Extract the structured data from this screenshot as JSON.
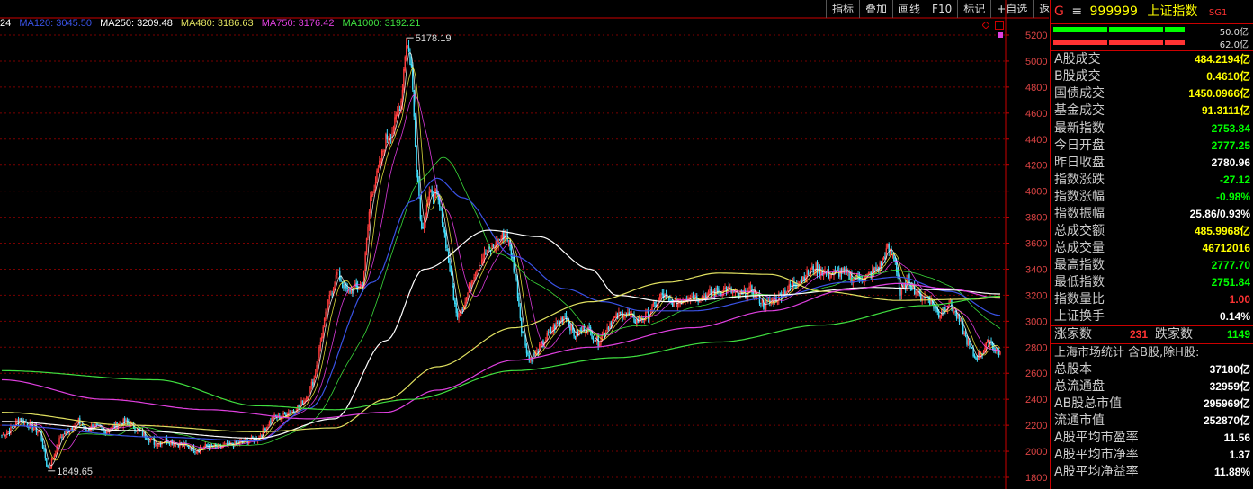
{
  "ma_legend": [
    {
      "label": "24",
      "color": "#ffffff"
    },
    {
      "label": "MA120: 3045.50",
      "color": "#3a53e6"
    },
    {
      "label": "MA250: 3209.48",
      "color": "#ffffff"
    },
    {
      "label": "MA480: 3186.63",
      "color": "#e0e060"
    },
    {
      "label": "MA750: 3176.42",
      "color": "#e040e0"
    },
    {
      "label": "MA1000: 3192.21",
      "color": "#40e040"
    }
  ],
  "toolbar": [
    "指标",
    "叠加",
    "画线",
    "F10",
    "标记",
    "+自选",
    "返回"
  ],
  "quote": {
    "g": "G",
    "eq": "≡",
    "code": "999999",
    "name": "上证指数",
    "sg": "SG1",
    "ratio_top": "50.0亿",
    "ratio_bottom": "62.0亿",
    "ratio_top_fill": 0.5,
    "ratio_bottom_fill": 0.62,
    "colors": {
      "up": "#ff3333",
      "down": "#00ff00",
      "flat": "#ffffff",
      "accent": "#ffff00"
    }
  },
  "volume_rows": [
    {
      "label": "A股成交",
      "value": "484.2194亿"
    },
    {
      "label": "B股成交",
      "value": "0.4610亿"
    },
    {
      "label": "国债成交",
      "value": "1450.0966亿"
    },
    {
      "label": "基金成交",
      "value": "91.3111亿"
    }
  ],
  "index_rows": [
    {
      "label": "最新指数",
      "value": "2753.84",
      "color": "g2"
    },
    {
      "label": "今日开盘",
      "value": "2777.25",
      "color": "g2"
    },
    {
      "label": "昨日收盘",
      "value": "2780.96",
      "color": "w"
    },
    {
      "label": "指数涨跌",
      "value": "-27.12",
      "color": "g2"
    },
    {
      "label": "指数涨幅",
      "value": "-0.98%",
      "color": "g2"
    },
    {
      "label": "指数振幅",
      "value": "25.86/0.93%",
      "color": "w"
    },
    {
      "label": "总成交额",
      "value": "485.9968亿",
      "color": "y"
    },
    {
      "label": "总成交量",
      "value": "46712016",
      "color": "y"
    },
    {
      "label": "最高指数",
      "value": "2777.70",
      "color": "g2"
    },
    {
      "label": "最低指数",
      "value": "2751.84",
      "color": "g2"
    },
    {
      "label": "指数量比",
      "value": "1.00",
      "color": "r"
    },
    {
      "label": "上证换手",
      "value": "0.14%",
      "color": "w"
    }
  ],
  "rise_fall": {
    "rise_label": "涨家数",
    "rise": "231",
    "fall_label": "跌家数",
    "fall": "1149"
  },
  "market_stats_title": "上海市场统计 含B股,除H股:",
  "market_rows": [
    {
      "label": "总股本",
      "value": "37180亿"
    },
    {
      "label": "总流通盘",
      "value": "32959亿"
    },
    {
      "label": "AB股总市值",
      "value": "295969亿"
    },
    {
      "label": "流通市值",
      "value": "252870亿"
    },
    {
      "label": "A股平均市盈率",
      "value": "11.56"
    },
    {
      "label": "A股平均市净率",
      "value": "1.37"
    },
    {
      "label": "A股平均净益率",
      "value": "11.88%"
    }
  ],
  "chart_data": {
    "type": "line",
    "ylim": [
      1800,
      5200
    ],
    "yticks": [
      1800,
      2000,
      2200,
      2400,
      2600,
      2800,
      3000,
      3200,
      3400,
      3600,
      3800,
      4000,
      4200,
      4400,
      4600,
      4800,
      5000,
      5200
    ],
    "annotations": [
      {
        "text": "5178.19",
        "x": 316,
        "y": 5178.19
      },
      {
        "text": "1849.65",
        "x": 36,
        "y": 1849.65
      }
    ],
    "x_count": 780,
    "price_anchors": [
      [
        0,
        2120
      ],
      [
        6,
        2160
      ],
      [
        14,
        2250
      ],
      [
        22,
        2200
      ],
      [
        30,
        2140
      ],
      [
        36,
        1849.65
      ],
      [
        40,
        1950
      ],
      [
        46,
        2110
      ],
      [
        54,
        2180
      ],
      [
        60,
        2230
      ],
      [
        66,
        2160
      ],
      [
        72,
        2200
      ],
      [
        80,
        2150
      ],
      [
        88,
        2190
      ],
      [
        96,
        2230
      ],
      [
        104,
        2180
      ],
      [
        112,
        2120
      ],
      [
        120,
        2060
      ],
      [
        128,
        2090
      ],
      [
        136,
        2060
      ],
      [
        144,
        2040
      ],
      [
        152,
        2010
      ],
      [
        160,
        2040
      ],
      [
        170,
        2030
      ],
      [
        180,
        2050
      ],
      [
        190,
        2080
      ],
      [
        200,
        2100
      ],
      [
        206,
        2180
      ],
      [
        212,
        2260
      ],
      [
        218,
        2260
      ],
      [
        224,
        2300
      ],
      [
        232,
        2340
      ],
      [
        238,
        2420
      ],
      [
        244,
        2560
      ],
      [
        250,
        2900
      ],
      [
        256,
        3180
      ],
      [
        262,
        3370
      ],
      [
        270,
        3230
      ],
      [
        276,
        3250
      ],
      [
        282,
        3280
      ],
      [
        288,
        3950
      ],
      [
        294,
        4150
      ],
      [
        300,
        4400
      ],
      [
        306,
        4480
      ],
      [
        312,
        4700
      ],
      [
        316,
        5178.19
      ],
      [
        320,
        4950
      ],
      [
        324,
        4200
      ],
      [
        328,
        3700
      ],
      [
        332,
        3900
      ],
      [
        336,
        4000
      ],
      [
        340,
        3950
      ],
      [
        344,
        3800
      ],
      [
        350,
        3400
      ],
      [
        355,
        3050
      ],
      [
        362,
        3150
      ],
      [
        368,
        3350
      ],
      [
        376,
        3500
      ],
      [
        382,
        3550
      ],
      [
        388,
        3620
      ],
      [
        394,
        3680
      ],
      [
        398,
        3520
      ],
      [
        402,
        3300
      ],
      [
        406,
        2950
      ],
      [
        412,
        2700
      ],
      [
        418,
        2760
      ],
      [
        426,
        2880
      ],
      [
        432,
        2960
      ],
      [
        440,
        3050
      ],
      [
        448,
        2880
      ],
      [
        456,
        2960
      ],
      [
        466,
        2840
      ],
      [
        476,
        3000
      ],
      [
        486,
        3070
      ],
      [
        496,
        3000
      ],
      [
        506,
        3060
      ],
      [
        516,
        3200
      ],
      [
        526,
        3130
      ],
      [
        536,
        3200
      ],
      [
        546,
        3180
      ],
      [
        556,
        3220
      ],
      [
        566,
        3250
      ],
      [
        576,
        3190
      ],
      [
        586,
        3240
      ],
      [
        596,
        3120
      ],
      [
        606,
        3180
      ],
      [
        616,
        3260
      ],
      [
        626,
        3340
      ],
      [
        636,
        3410
      ],
      [
        646,
        3360
      ],
      [
        656,
        3380
      ],
      [
        666,
        3330
      ],
      [
        676,
        3340
      ],
      [
        686,
        3420
      ],
      [
        692,
        3560
      ],
      [
        698,
        3470
      ],
      [
        702,
        3200
      ],
      [
        708,
        3320
      ],
      [
        716,
        3200
      ],
      [
        724,
        3180
      ],
      [
        732,
        3050
      ],
      [
        740,
        3150
      ],
      [
        748,
        3000
      ],
      [
        754,
        2850
      ],
      [
        760,
        2720
      ],
      [
        766,
        2760
      ],
      [
        772,
        2860
      ],
      [
        776,
        2780
      ],
      [
        780,
        2753.84
      ]
    ],
    "ma_series": [
      {
        "name": "MA120",
        "color": "#3a53e6",
        "points": [
          [
            0,
            2200
          ],
          [
            120,
            2110
          ],
          [
            200,
            2080
          ],
          [
            240,
            2330
          ],
          [
            290,
            3300
          ],
          [
            320,
            3920
          ],
          [
            340,
            4100
          ],
          [
            360,
            3950
          ],
          [
            400,
            3500
          ],
          [
            440,
            3250
          ],
          [
            470,
            3150
          ],
          [
            500,
            3080
          ],
          [
            540,
            3080
          ],
          [
            600,
            3180
          ],
          [
            660,
            3300
          ],
          [
            700,
            3340
          ],
          [
            740,
            3230
          ],
          [
            780,
            3045.5
          ]
        ]
      },
      {
        "name": "MA250",
        "color": "#ffffff",
        "points": [
          [
            0,
            2230
          ],
          [
            100,
            2160
          ],
          [
            200,
            2100
          ],
          [
            260,
            2250
          ],
          [
            300,
            2850
          ],
          [
            330,
            3400
          ],
          [
            380,
            3700
          ],
          [
            420,
            3650
          ],
          [
            460,
            3400
          ],
          [
            480,
            3200
          ],
          [
            520,
            3150
          ],
          [
            600,
            3200
          ],
          [
            680,
            3260
          ],
          [
            740,
            3240
          ],
          [
            780,
            3209.48
          ]
        ]
      },
      {
        "name": "MA480",
        "color": "#e0e060",
        "points": [
          [
            0,
            2300
          ],
          [
            100,
            2200
          ],
          [
            200,
            2150
          ],
          [
            260,
            2180
          ],
          [
            300,
            2400
          ],
          [
            340,
            2650
          ],
          [
            400,
            2950
          ],
          [
            460,
            3150
          ],
          [
            520,
            3300
          ],
          [
            560,
            3370
          ],
          [
            600,
            3360
          ],
          [
            640,
            3230
          ],
          [
            700,
            3160
          ],
          [
            760,
            3170
          ],
          [
            780,
            3186.63
          ]
        ]
      },
      {
        "name": "MA750",
        "color": "#e040e0",
        "points": [
          [
            0,
            2550
          ],
          [
            80,
            2400
          ],
          [
            160,
            2320
          ],
          [
            240,
            2250
          ],
          [
            300,
            2300
          ],
          [
            340,
            2470
          ],
          [
            400,
            2700
          ],
          [
            460,
            2800
          ],
          [
            540,
            2950
          ],
          [
            600,
            3080
          ],
          [
            660,
            3240
          ],
          [
            700,
            3290
          ],
          [
            740,
            3250
          ],
          [
            780,
            3176.42
          ]
        ]
      },
      {
        "name": "MA1000",
        "color": "#40e040",
        "points": [
          [
            0,
            2620
          ],
          [
            120,
            2550
          ],
          [
            200,
            2350
          ],
          [
            260,
            2320
          ],
          [
            320,
            2400
          ],
          [
            400,
            2620
          ],
          [
            480,
            2720
          ],
          [
            560,
            2840
          ],
          [
            640,
            2970
          ],
          [
            720,
            3120
          ],
          [
            780,
            3192.21
          ]
        ]
      }
    ]
  }
}
